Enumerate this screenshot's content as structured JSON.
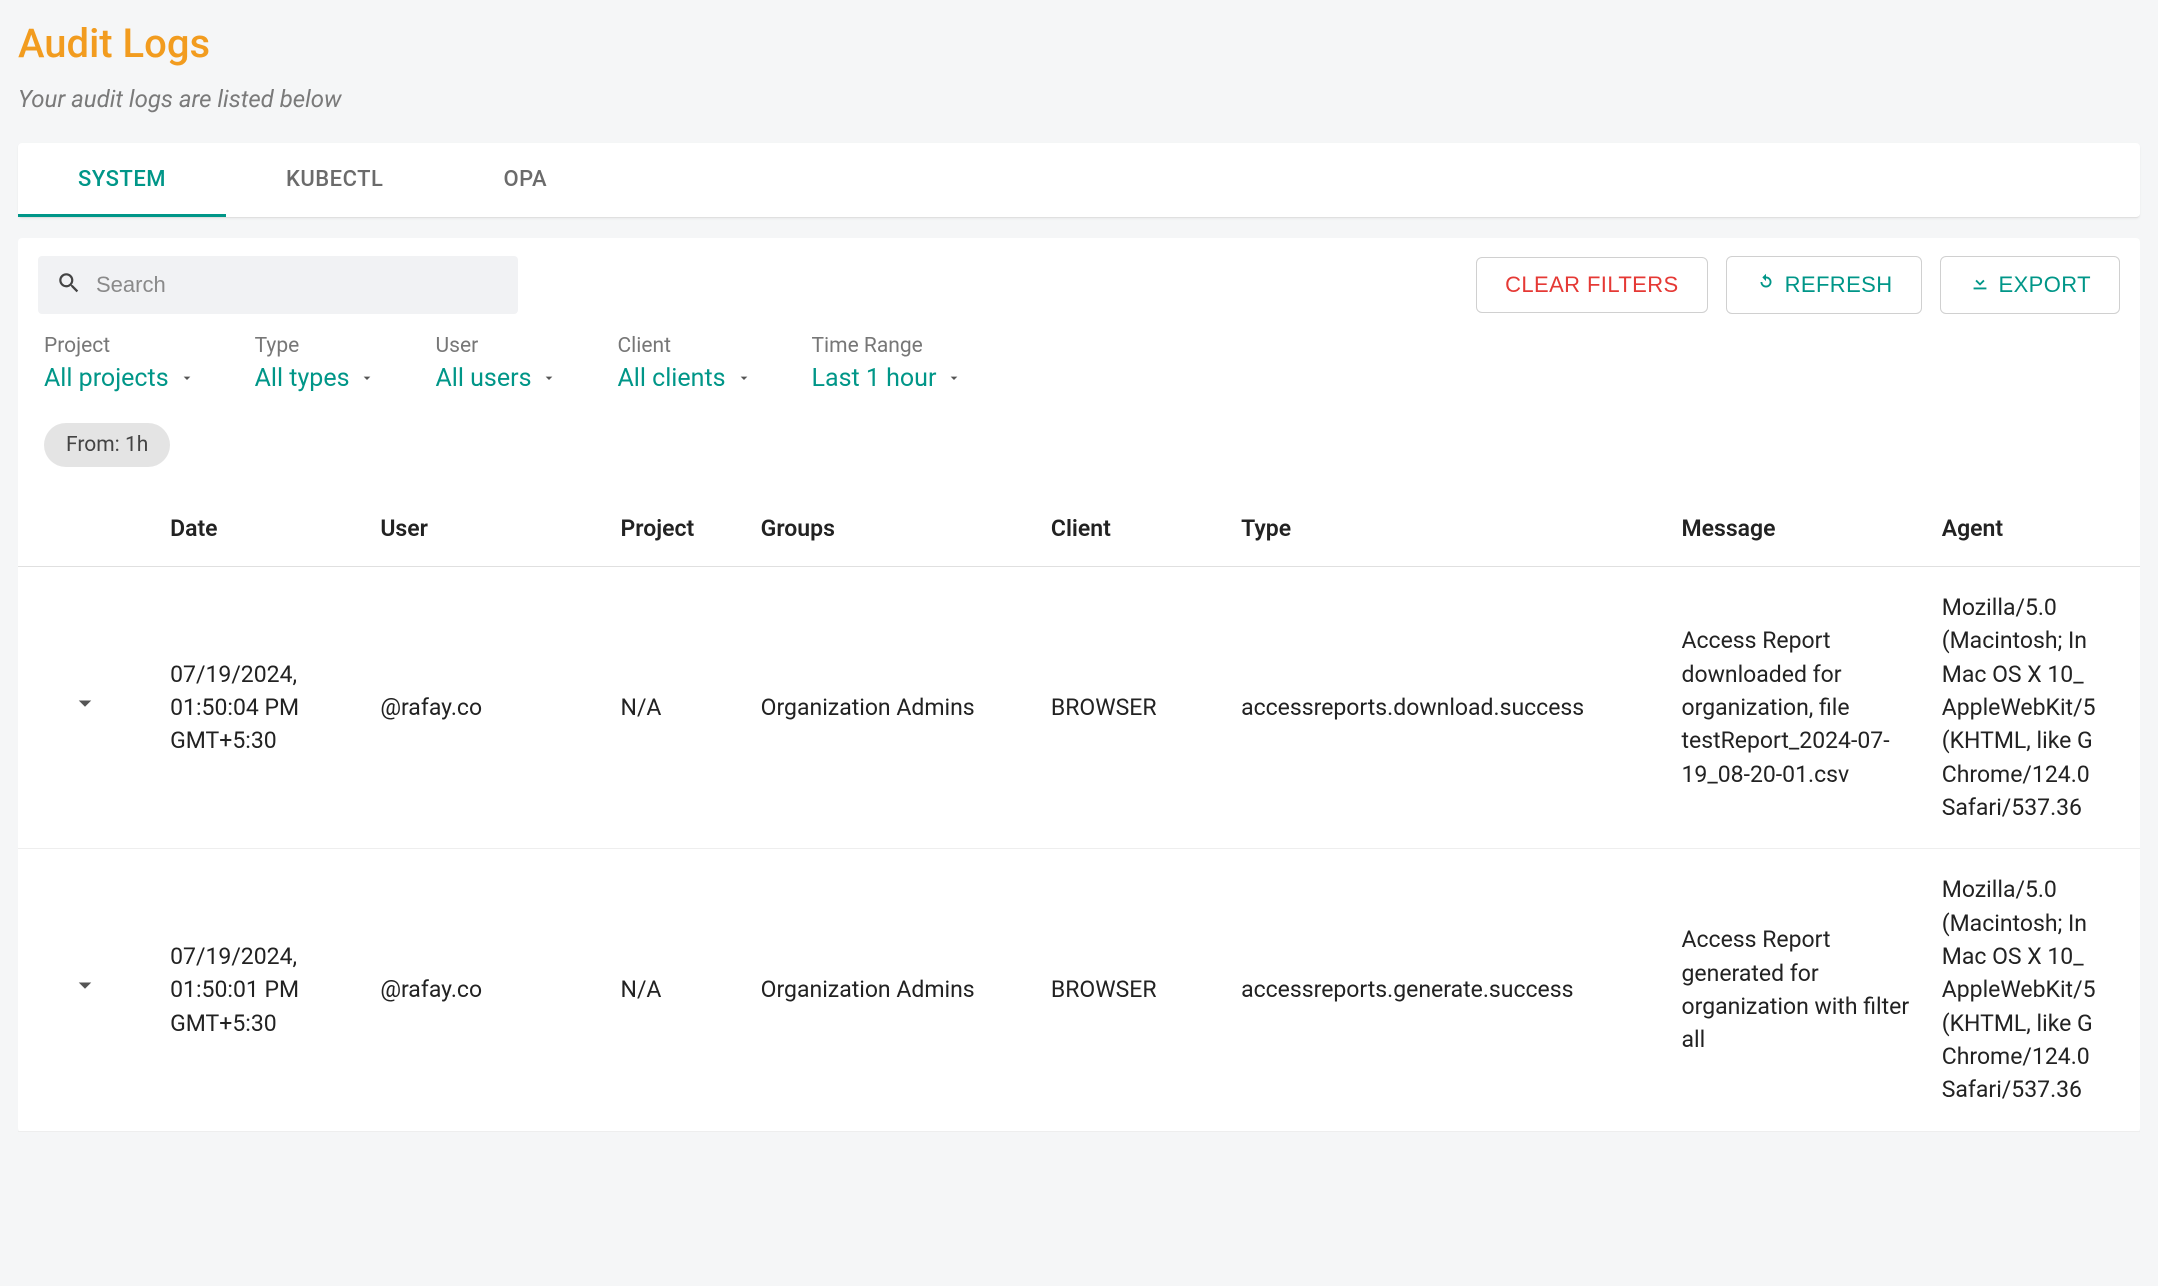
{
  "header": {
    "title": "Audit Logs",
    "subtitle": "Your audit logs are listed below"
  },
  "tabs": [
    {
      "label": "SYSTEM",
      "active": true
    },
    {
      "label": "KUBECTL",
      "active": false
    },
    {
      "label": "OPA",
      "active": false
    }
  ],
  "toolbar": {
    "search_placeholder": "Search",
    "clear_label": "CLEAR FILTERS",
    "refresh_label": "REFRESH",
    "export_label": "EXPORT"
  },
  "filters": {
    "project": {
      "label": "Project",
      "value": "All projects"
    },
    "type": {
      "label": "Type",
      "value": "All types"
    },
    "user": {
      "label": "User",
      "value": "All users"
    },
    "client": {
      "label": "Client",
      "value": "All clients"
    },
    "time": {
      "label": "Time Range",
      "value": "Last 1 hour"
    }
  },
  "chip": "From: 1h",
  "columns": {
    "date": "Date",
    "user": "User",
    "project": "Project",
    "groups": "Groups",
    "client": "Client",
    "type": "Type",
    "message": "Message",
    "agent": "Agent"
  },
  "rows": [
    {
      "date": "07/19/2024, 01:50:04 PM GMT+5:30",
      "user": "@rafay.co",
      "project": "N/A",
      "groups": "Organization Admins",
      "client": "BROWSER",
      "type": "accessreports.download.success",
      "message": "Access Report downloaded for organization, file testReport_2024-07-19_08-20-01.csv",
      "agent": "Mozilla/5.0 (Macintosh; In Mac OS X 10_ AppleWebKit/5 (KHTML, like G Chrome/124.0 Safari/537.36"
    },
    {
      "date": "07/19/2024, 01:50:01 PM GMT+5:30",
      "user": "@rafay.co",
      "project": "N/A",
      "groups": "Organization Admins",
      "client": "BROWSER",
      "type": "accessreports.generate.success",
      "message": "Access Report generated for organization with filter all",
      "agent": "Mozilla/5.0 (Macintosh; In Mac OS X 10_ AppleWebKit/5 (KHTML, like G Chrome/124.0 Safari/537.36"
    }
  ]
}
